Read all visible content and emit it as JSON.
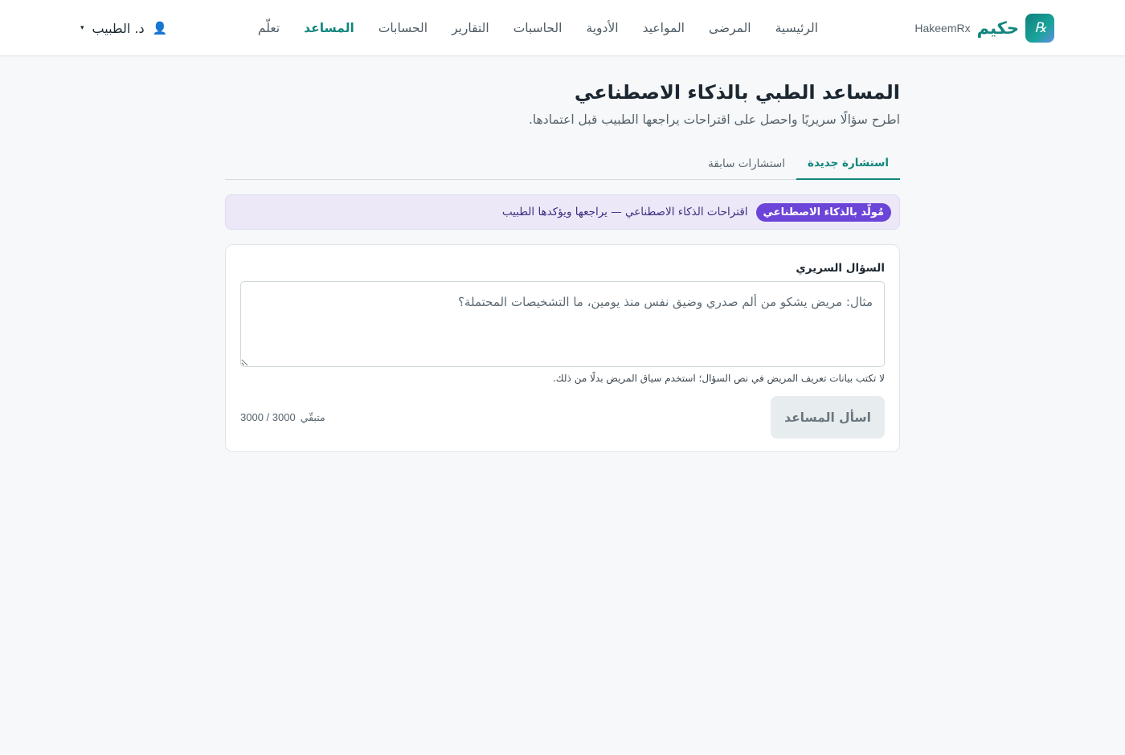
{
  "brand": {
    "logo_text": "℞",
    "name": "حكيم",
    "latin_name": "HakeemRx"
  },
  "nav": {
    "items": [
      {
        "label": "الرئيسية",
        "active": false
      },
      {
        "label": "المرضى",
        "active": false
      },
      {
        "label": "المواعيد",
        "active": false
      },
      {
        "label": "الأدوية",
        "active": false
      },
      {
        "label": "الحاسبات",
        "active": false
      },
      {
        "label": "التقارير",
        "active": false
      },
      {
        "label": "الحسابات",
        "active": false
      },
      {
        "label": "المساعد",
        "active": true
      },
      {
        "label": "تعلّم",
        "active": false
      }
    ]
  },
  "user": {
    "name": "د. الطبيب",
    "icon": "user-icon",
    "caret": "▾"
  },
  "page": {
    "title": "المساعد الطبي بالذكاء الاصطناعي",
    "subtitle": "اطرح سؤالًا سريريًا واحصل على اقتراحات يراجعها الطبيب قبل اعتمادها."
  },
  "tabs": [
    {
      "label": "استشارة جديدة",
      "active": true
    },
    {
      "label": "استشارات سابقة",
      "active": false
    }
  ],
  "ai_banner": {
    "badge": "مُولّد بالذكاء الاصطناعي",
    "text": "اقتراحات الذكاء الاصطناعي — يراجعها ويؤكدها الطبيب"
  },
  "form": {
    "label": "السؤال السريري",
    "value": "",
    "placeholder": "مثال: مريض يشكو من ألم صدري وضيق نفس منذ يومين، ما التشخيصات المحتملة؟",
    "hint": "لا تكتب بيانات تعريف المريض في نص السؤال؛ استخدم سياق المريض بدلًا من ذلك.",
    "submit_label": "اسأل المساعد",
    "counter_label": "متبقّي",
    "counter_value": "3000 / 3000"
  },
  "colors": {
    "primary": "#13867e",
    "ai_accent": "#6c45d8",
    "ai_banner_bg": "#ece8f8",
    "page_bg": "#f6f8f9"
  }
}
